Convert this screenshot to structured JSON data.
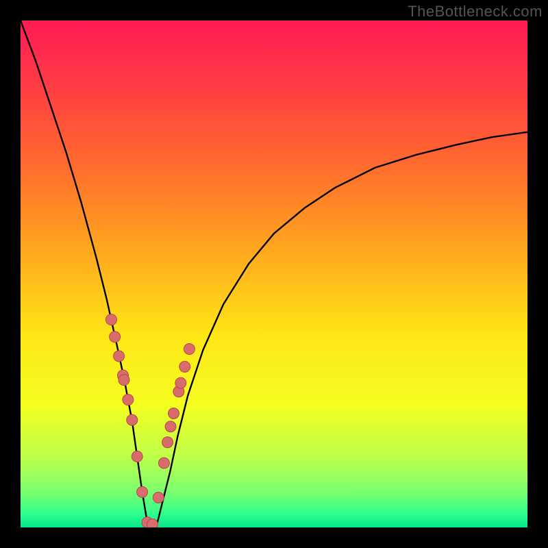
{
  "watermark": "TheBottleneck.com",
  "colors": {
    "frame": "#000000",
    "curve": "#000000",
    "marker_fill": "#d86b6b",
    "marker_stroke": "#b54848",
    "gradient_stops": [
      {
        "offset": 0.0,
        "color": "#ff1b55"
      },
      {
        "offset": 0.12,
        "color": "#ff3a45"
      },
      {
        "offset": 0.28,
        "color": "#ff6a2e"
      },
      {
        "offset": 0.45,
        "color": "#ffa61f"
      },
      {
        "offset": 0.62,
        "color": "#ffe615"
      },
      {
        "offset": 0.76,
        "color": "#f4ff20"
      },
      {
        "offset": 0.86,
        "color": "#beff4a"
      },
      {
        "offset": 0.93,
        "color": "#7bff6e"
      },
      {
        "offset": 0.975,
        "color": "#2dff8e"
      },
      {
        "offset": 1.0,
        "color": "#06e38a"
      }
    ]
  },
  "chart_data": {
    "type": "line",
    "title": "",
    "xlabel": "",
    "ylabel": "",
    "xlim": [
      0,
      100
    ],
    "ylim": [
      0,
      100
    ],
    "grid": false,
    "curve_note": "V-shaped bottleneck curve; y ≈ 100 at x=0, dips to ~0 near x≈25, rises toward ~78 at x=100",
    "x": [
      0,
      3,
      6,
      9,
      12,
      15,
      17,
      19,
      20.5,
      22,
      23,
      24,
      25,
      26,
      27,
      28,
      29.5,
      31,
      33,
      36,
      40,
      45,
      50,
      56,
      62,
      70,
      78,
      86,
      93,
      100
    ],
    "y": [
      100,
      92,
      83,
      74,
      64,
      53,
      45,
      36,
      29,
      21,
      14,
      7,
      1,
      0.5,
      1,
      5,
      11,
      18,
      26,
      35,
      44,
      52,
      58,
      63,
      67,
      71,
      73.5,
      75.5,
      77,
      78
    ],
    "series": [
      {
        "name": "highlight-markers",
        "type": "scatter",
        "x": [
          17.9,
          18.6,
          19.4,
          20.2,
          20.4,
          21.2,
          22.0,
          23.0,
          24.0,
          25.0,
          26.0,
          27.2,
          28.3,
          29.0,
          29.6,
          30.2,
          31.2,
          31.6,
          32.4,
          33.3
        ],
        "y": [
          41.0,
          37.6,
          33.8,
          30.0,
          29.1,
          25.2,
          21.2,
          14.0,
          7.0,
          1.0,
          0.6,
          5.9,
          12.7,
          16.8,
          19.9,
          22.5,
          26.8,
          28.5,
          31.7,
          35.2
        ]
      }
    ]
  }
}
